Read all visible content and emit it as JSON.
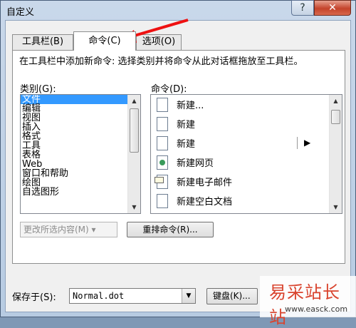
{
  "window": {
    "title": "自定义",
    "help_label": "?",
    "close_label": "✕",
    "accent": "#3399ff",
    "close_color": "#c4432b"
  },
  "tabs": [
    {
      "label": "工具栏(B)",
      "selected": false
    },
    {
      "label": "命令(C)",
      "selected": true
    },
    {
      "label": "选项(O)",
      "selected": false
    }
  ],
  "instruction": "在工具栏中添加新命令: 选择类别并将命令从此对话框拖放至工具栏。",
  "categories": {
    "label": "类别(G):",
    "selected": "文件",
    "items": [
      "文件",
      "编辑",
      "视图",
      "插入",
      "格式",
      "工具",
      "表格",
      "Web",
      "窗口和帮助",
      "绘图",
      "自选图形"
    ]
  },
  "commands": {
    "label": "命令(D):",
    "items": [
      {
        "label": "新建...",
        "icon": "blank-document-icon"
      },
      {
        "label": "新建",
        "icon": "blank-document-icon"
      },
      {
        "label": "新建",
        "icon": "blank-document-icon",
        "has_submenu": true
      },
      {
        "label": "新建网页",
        "icon": "web-page-icon"
      },
      {
        "label": "新建电子邮件",
        "icon": "email-icon"
      },
      {
        "label": "新建空白文档",
        "icon": "blank-document-icon"
      }
    ]
  },
  "buttons": {
    "modify_selection": "更改所选内容(M) ▾",
    "rearrange": "重排命令(R)...",
    "keyboard": "键盘(K)..."
  },
  "save_in": {
    "label": "保存于(S):",
    "value": "Normal.dot"
  },
  "watermark": {
    "text": "易采站长站",
    "url": "www.easck.com"
  }
}
